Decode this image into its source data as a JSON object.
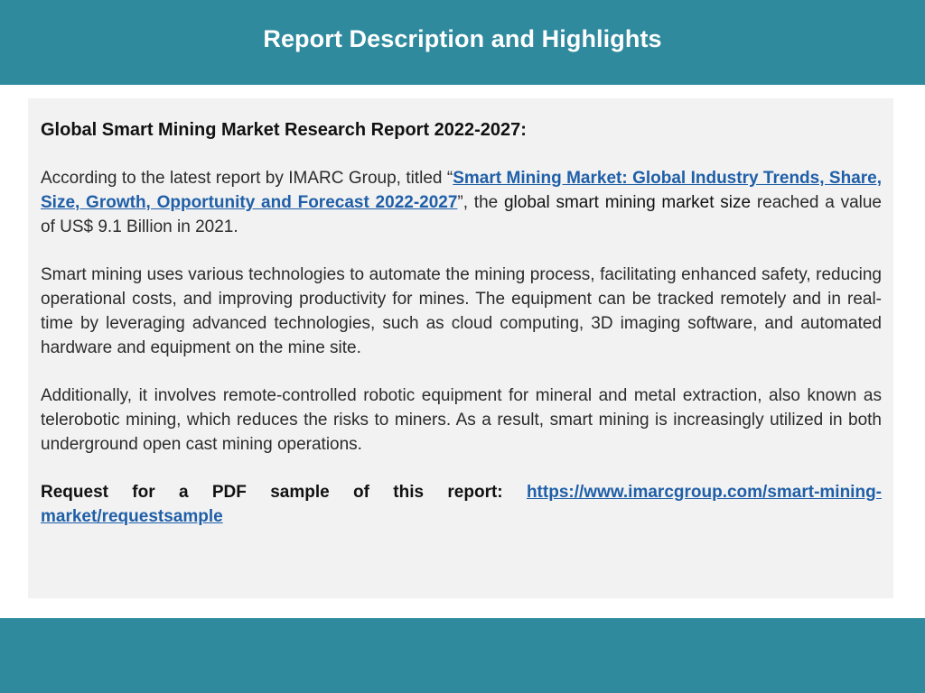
{
  "header": {
    "title": "Report Description and Highlights"
  },
  "report": {
    "heading": "Global Smart Mining Market Research Report 2022-2027:",
    "intro": {
      "before_link": "According to the latest report by IMARC Group, titled “",
      "link_text": "Smart Mining Market: Global Industry Trends, Share, Size, Growth, Opportunity and Forecast 2022-2027",
      "after_link": "”, the ",
      "highlight": "global smart mining market size",
      "end": " reached a value of US$ 9.1 Billion in 2021."
    },
    "paragraph_2": "Smart mining uses various technologies to automate the mining process, facilitating enhanced safety, reducing operational costs, and improving productivity for mines. The equipment can be tracked remotely and in real-time by leveraging advanced technologies, such as cloud computing, 3D imaging software, and automated hardware and equipment on the mine site.",
    "paragraph_3": "Additionally, it involves remote-controlled robotic equipment for mineral and metal extraction, also known as telerobotic mining, which reduces the risks to miners. As a result, smart mining is increasingly utilized in both underground open cast mining operations.",
    "request": {
      "label": "Request for a PDF sample of this report: ",
      "url_text": "https://www.imarcgroup.com/smart-mining-market/requestsample"
    }
  },
  "colors": {
    "header_bar": "#2f8a9e",
    "panel": "#f2f2f2",
    "link": "#1f5fa8"
  }
}
